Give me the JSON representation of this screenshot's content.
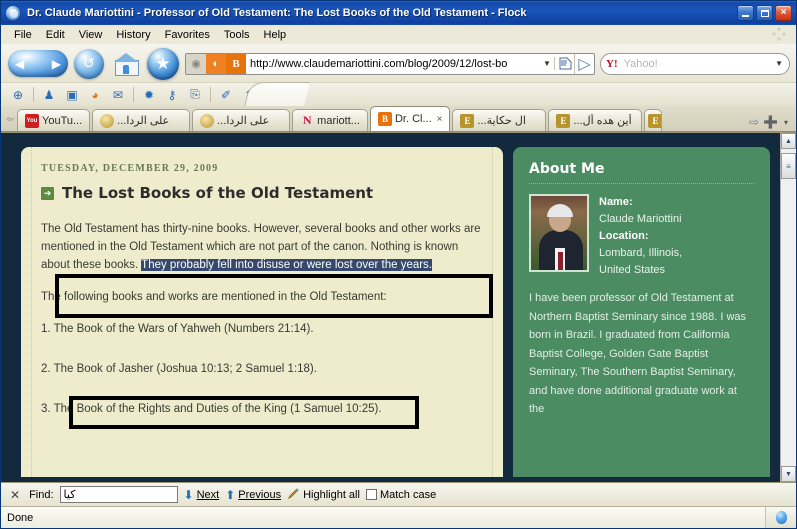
{
  "window": {
    "title": "Dr. Claude Mariottini - Professor of Old Testament: The Lost Books of the Old Testament - Flock",
    "minimize_label": "",
    "maximize_label": "",
    "close_label": "×"
  },
  "menubar": {
    "items": [
      "File",
      "Edit",
      "View",
      "History",
      "Favorites",
      "Tools",
      "Help"
    ]
  },
  "navbar": {
    "back_forward_icon": "back-forward-icon",
    "reload_icon": "reload-icon",
    "home_icon": "home-icon",
    "favorites_icon": "star-icon",
    "url": "http://www.claudemariottini.com/blog/2009/12/lost-bo",
    "url_dropdown": "▼",
    "feed_badge": "rss-icon",
    "blogger_badge": "B",
    "camera_badge": "camera-icon",
    "go_icon": "go-icon",
    "search": {
      "provider": "Y!",
      "placeholder": "Yahoo!",
      "dropdown": "▼"
    }
  },
  "iconbar": {
    "icons": [
      {
        "name": "web-icon",
        "glyph": "⊕"
      },
      {
        "name": "people-icon",
        "glyph": "♟"
      },
      {
        "name": "photos-icon",
        "glyph": "▣"
      },
      {
        "name": "feeds-icon",
        "glyph": "◕"
      },
      {
        "name": "mail-icon",
        "glyph": "✉"
      },
      {
        "name": "favorites-magic-icon",
        "glyph": "✹"
      },
      {
        "name": "accounts-key-icon",
        "glyph": "⚷"
      },
      {
        "name": "clipboard-icon",
        "glyph": "⎘"
      },
      {
        "name": "blog-editor-icon",
        "glyph": "✐"
      },
      {
        "name": "upload-icon",
        "glyph": "⬆"
      }
    ]
  },
  "tabs": [
    {
      "label": "YouTu...",
      "favicon": "youtube-icon",
      "favicon_text": "You",
      "active": false
    },
    {
      "label": "على الردا...",
      "favicon": "gold-icon",
      "favicon_text": "",
      "active": false
    },
    {
      "label": "على الردا...",
      "favicon": "gold-icon",
      "favicon_text": "",
      "active": false
    },
    {
      "label": "mariott...",
      "favicon": "netvibes-icon",
      "favicon_text": "N",
      "active": false
    },
    {
      "label": "Dr. Cl...",
      "favicon": "blogger-icon",
      "favicon_text": "B",
      "active": true,
      "close": "×"
    },
    {
      "label": "ال حكاية...",
      "favicon": "e-icon",
      "favicon_text": "E",
      "active": false
    },
    {
      "label": "أين هده أل...",
      "favicon": "e-icon",
      "favicon_text": "E",
      "active": false
    },
    {
      "label": "",
      "favicon": "e-icon",
      "favicon_text": "E",
      "active": false
    }
  ],
  "tab_controls": {
    "scroll_left": "⇦",
    "scroll_right": "⇨",
    "new_tab": "➕",
    "tab_list": "▾"
  },
  "post": {
    "date": "TUESDAY, DECEMBER 29, 2009",
    "title": "The Lost Books of the Old Testament",
    "bullet": "➔",
    "paragraph_1_pre": "The Old Testament has thirty-nine books. However, several books and other works are mentioned in the Old Testament which are not part of the canon. Nothing is known about these books. ",
    "paragraph_1_selected": "They probably fell into disuse or were lost over the years.",
    "paragraph_2": "The following books and works are mentioned in the Old Testament:",
    "list_items": [
      "1. The Book of the Wars of Yahweh (Numbers 21:14).",
      "2. The Book of Jasher (Joshua 10:13; 2 Samuel 1:18).",
      "3. The Book of the Rights and Duties of the King (1 Samuel 10:25)."
    ]
  },
  "about": {
    "heading": "About Me",
    "name_label": "Name:",
    "name_value": "Claude Mariottini",
    "location_label": "Location:",
    "location_value_1": "Lombard, Illinois,",
    "location_value_2": "United States",
    "bio": "I have been professor of Old Testament at Northern Baptist Seminary since 1988. I was born in Brazil. I graduated from California Baptist College, Golden Gate Baptist Seminary, The Southern Baptist Seminary, and have done additional graduate work at the"
  },
  "findbar": {
    "close": "✕",
    "label": "Find:",
    "value": "كيا",
    "placeholder": "",
    "next": "Next",
    "previous": "Previous",
    "highlight_all": "Highlight all",
    "match_case": "Match case",
    "down_arrow": "⬇",
    "up_arrow": "⬆",
    "highlighter_icon": "highlighter-icon"
  },
  "statusbar": {
    "text": "Done",
    "balloon_icon": "balloon-icon"
  },
  "scrollbar": {
    "up": "▲",
    "down": "▼",
    "thumb": "≡"
  },
  "colors": {
    "page_bg": "#13293d",
    "post_bg": "#eeeccd",
    "about_bg": "#4b8c63",
    "selection_bg": "#36486b",
    "date_text": "#6a7a4e"
  }
}
